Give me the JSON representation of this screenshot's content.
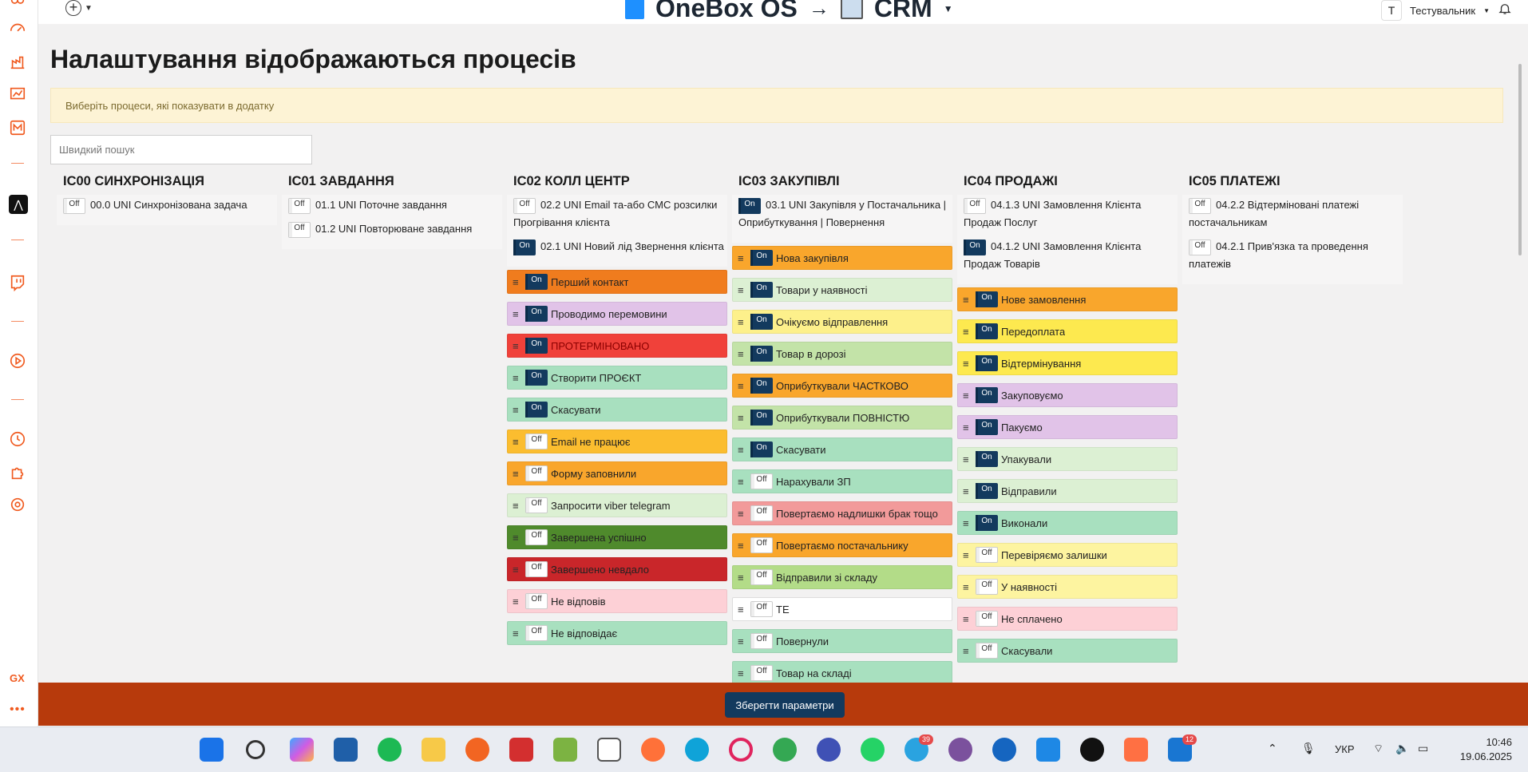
{
  "topbar": {
    "brand": "OneBox OS",
    "arrow": "→",
    "section": "CRM",
    "user_initial": "T",
    "user_name": "Тестувальник"
  },
  "page": {
    "title": "Налаштування відображаються процесів",
    "hint": "Виберіть процеси, які показувати в додатку",
    "search_placeholder": "Швидкий пошук",
    "save_label": "Зберегти параметри"
  },
  "toggle_labels": {
    "on": "On",
    "off": "Off"
  },
  "columns": [
    {
      "title": "IC00 СИНХРОНІЗАЦІЯ",
      "processes": [
        {
          "label": "00.0 UNI Синхронізована задача",
          "on": false
        }
      ],
      "stages": []
    },
    {
      "title": "IC01 ЗАВДАННЯ",
      "processes": [
        {
          "label": "01.1 UNI Поточне завдання",
          "on": false
        },
        {
          "label": "01.2 UNI Повторюване завдання",
          "on": false
        }
      ],
      "stages": []
    },
    {
      "title": "IC02 КОЛЛ ЦЕНТР",
      "processes": [
        {
          "label": "02.2 UNI Email та-або СМС розсилки Прогрівання клієнта",
          "on": false
        },
        {
          "label": "02.1 UNI Новий лід Звернення клієнта",
          "on": true
        }
      ],
      "stages": [
        {
          "label": "Перший контакт",
          "on": true,
          "color": "#f07c1e"
        },
        {
          "label": "Проводимо перемовини",
          "on": true,
          "color": "#e1c3e8"
        },
        {
          "label": "ПРОТЕРМІНОВАНО",
          "on": true,
          "color": "#f0413a"
        },
        {
          "label": "Створити ПРОЄКТ",
          "on": true,
          "color": "#a8e0bf"
        },
        {
          "label": "Скасувати",
          "on": true,
          "color": "#a8e0bf"
        },
        {
          "label": "Email не працює",
          "on": false,
          "color": "#fbbd2f"
        },
        {
          "label": "Форму заповнили",
          "on": false,
          "color": "#f9a62c"
        },
        {
          "label": "Запросити viber telegram",
          "on": false,
          "color": "#dcf0d3"
        },
        {
          "label": "Завершена успішно",
          "on": false,
          "color": "#4f8a2c"
        },
        {
          "label": "Завершено невдало",
          "on": false,
          "color": "#c9262a"
        },
        {
          "label": "Не відповів",
          "on": false,
          "color": "#fdd0d6"
        },
        {
          "label": "Не відповідає",
          "on": false,
          "color": "#a8e0bf"
        }
      ]
    },
    {
      "title": "IC03 ЗАКУПІВЛІ",
      "processes": [
        {
          "label": "03.1 UNI Закупівля у Постачальника | Оприбуткування | Повернення",
          "on": true
        }
      ],
      "stages": [
        {
          "label": "Нова закупівля",
          "on": true,
          "color": "#f9a62c"
        },
        {
          "label": "Товари у наявності",
          "on": true,
          "color": "#dcf0d3"
        },
        {
          "label": "Очікуємо відправлення",
          "on": true,
          "color": "#fdf08b"
        },
        {
          "label": "Товар в дорозі",
          "on": true,
          "color": "#c3e3a8"
        },
        {
          "label": "Оприбуткували ЧАСТКОВО",
          "on": true,
          "color": "#f9a62c"
        },
        {
          "label": "Оприбуткували ПОВНІСТЮ",
          "on": true,
          "color": "#c3e3a8"
        },
        {
          "label": "Скасувати",
          "on": true,
          "color": "#a8e0bf"
        },
        {
          "label": "Нарахували ЗП",
          "on": false,
          "color": "#a8e0bf"
        },
        {
          "label": "Повертаємо надлишки брак тощо",
          "on": false,
          "color": "#f29a9a"
        },
        {
          "label": "Повертаємо постачальнику",
          "on": false,
          "color": "#f9a62c"
        },
        {
          "label": "Відправили зі складу",
          "on": false,
          "color": "#b3dc88"
        },
        {
          "label": "ТЕ",
          "on": false,
          "color": "#ffffff"
        },
        {
          "label": "Повернули",
          "on": false,
          "color": "#a8e0bf"
        },
        {
          "label": "Товар на складі",
          "on": false,
          "color": "#a8e0bf"
        }
      ]
    },
    {
      "title": "IC04 ПРОДАЖІ",
      "processes": [
        {
          "label": "04.1.3 UNI Замовлення Клієнта Продаж Послуг",
          "on": false
        },
        {
          "label": "04.1.2 UNI Замовлення Клієнта Продаж Товарів",
          "on": true
        }
      ],
      "stages": [
        {
          "label": "Нове замовлення",
          "on": true,
          "color": "#f9a62c"
        },
        {
          "label": "Передоплата",
          "on": true,
          "color": "#fde94f"
        },
        {
          "label": "Відтермінування",
          "on": true,
          "color": "#fde94f"
        },
        {
          "label": "Закуповуємо",
          "on": true,
          "color": "#e1c3e8"
        },
        {
          "label": "Пакуємо",
          "on": true,
          "color": "#e1c3e8"
        },
        {
          "label": "Упакували",
          "on": true,
          "color": "#dcf0d3"
        },
        {
          "label": "Відправили",
          "on": true,
          "color": "#dcf0d3"
        },
        {
          "label": "Виконали",
          "on": true,
          "color": "#a8e0bf"
        },
        {
          "label": "Перевіряємо залишки",
          "on": false,
          "color": "#fdf4a0"
        },
        {
          "label": "У наявності",
          "on": false,
          "color": "#fdf4a0"
        },
        {
          "label": "Не сплачено",
          "on": false,
          "color": "#fdd0d6"
        },
        {
          "label": "Скасували",
          "on": false,
          "color": "#a8e0bf"
        }
      ]
    },
    {
      "title": "IC05 ПЛАТЕЖІ",
      "processes": [
        {
          "label": "04.2.2 Відтерміновані платежі постачальникам",
          "on": false
        },
        {
          "label": "04.2.1 Прив'язка та проведення платежів",
          "on": false
        }
      ],
      "stages": []
    }
  ],
  "taskbar": {
    "telegram_badge": "39",
    "last_badge": "12",
    "lang": "УКР",
    "time": "10:46",
    "date": "19.06.2025"
  },
  "sidebar": {
    "gx": "GX",
    "more": "•••"
  }
}
